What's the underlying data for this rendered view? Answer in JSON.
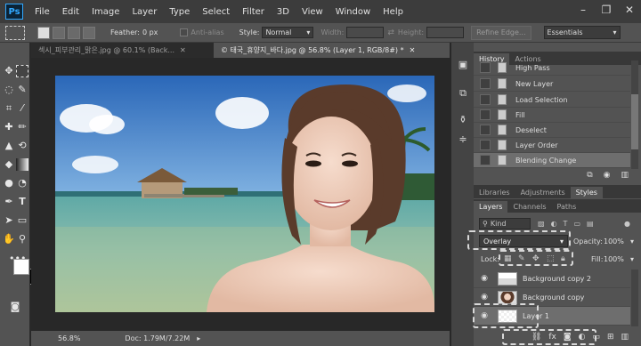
{
  "app": {
    "logo": "Ps"
  },
  "menu": [
    "File",
    "Edit",
    "Image",
    "Layer",
    "Type",
    "Select",
    "Filter",
    "3D",
    "View",
    "Window",
    "Help"
  ],
  "window_controls": {
    "minimize": "–",
    "restore": "❐",
    "close": "✕"
  },
  "options": {
    "feather_label": "Feather:",
    "feather_value": "0 px",
    "antialias_label": "Anti-alias",
    "style_label": "Style:",
    "style_value": "Normal",
    "width_label": "Width:",
    "height_label": "Height:",
    "refine_edge": "Refine Edge...",
    "workspace": "Essentials"
  },
  "doc_tabs": [
    {
      "label": "섹시_피부관리_맑은.jpg @ 60.1% (Back..."
    },
    {
      "label": "© 태국_휴양지_바다.jpg @ 56.8% (Layer 1, RGB/8#) *"
    }
  ],
  "status": {
    "zoom": "56.8%",
    "doc": "Doc: 1.79M/7.22M"
  },
  "history": {
    "tabs": [
      "History",
      "Actions"
    ],
    "items": [
      "High Pass",
      "New Layer",
      "Load Selection",
      "Fill",
      "Deselect",
      "Layer Order",
      "Blending Change"
    ]
  },
  "styles_tabs": [
    "Libraries",
    "Adjustments",
    "Styles"
  ],
  "layers_panel": {
    "tabs": [
      "Layers",
      "Channels",
      "Paths"
    ],
    "kind_label": "Kind",
    "blend_mode": "Overlay",
    "opacity_label": "Opacity:",
    "opacity_value": "100%",
    "lock_label": "Lock:",
    "fill_label": "Fill:",
    "fill_value": "100%",
    "layers": [
      {
        "name": "Background copy 2"
      },
      {
        "name": "Background copy"
      },
      {
        "name": "Layer 1"
      }
    ]
  },
  "colors": {
    "accent": "#31a8ff",
    "panel": "#535353",
    "dark": "#282828"
  }
}
